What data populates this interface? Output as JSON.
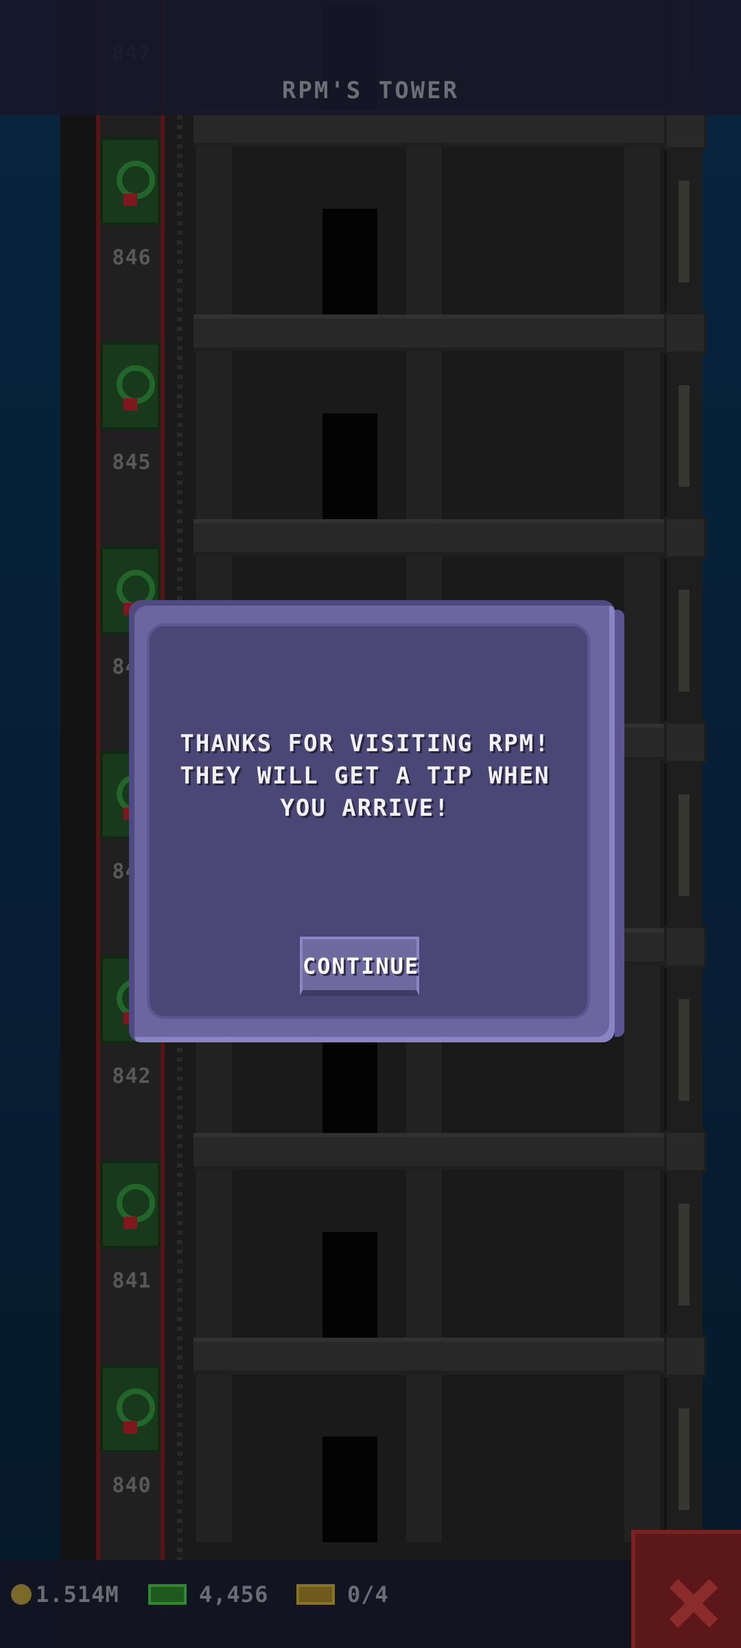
{
  "header": {
    "title": "RPM'S TOWER"
  },
  "floors": [
    {
      "number": "847"
    },
    {
      "number": "846"
    },
    {
      "number": "845"
    },
    {
      "number": "844"
    },
    {
      "number": "843"
    },
    {
      "number": "842"
    },
    {
      "number": "841"
    },
    {
      "number": "840"
    }
  ],
  "dialog": {
    "message": "THANKS FOR VISITING RPM! THEY WILL GET A TIP WHEN YOU ARRIVE!",
    "continue_label": "CONTINUE"
  },
  "status_bar": {
    "coins": "1.514M",
    "bux": "4,456",
    "tickets": "0/4",
    "coin_icon": "coin-icon",
    "bux_icon": "cash-icon",
    "ticket_icon": "ticket-icon"
  },
  "close_icon": "close-icon",
  "colors": {
    "sky": "#0b2a45",
    "dialog_bg": "#4a4777",
    "dialog_border": "#6c66a0",
    "close_button": "#5c1818",
    "elevator_stripe": "#7a1c1c"
  }
}
